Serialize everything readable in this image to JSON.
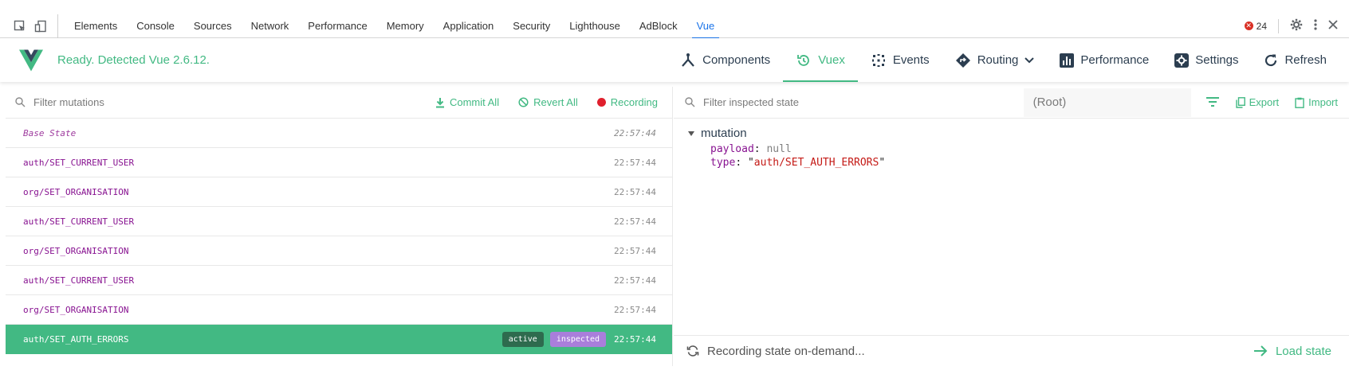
{
  "devtools": {
    "tabs": [
      "Elements",
      "Console",
      "Sources",
      "Network",
      "Performance",
      "Memory",
      "Application",
      "Security",
      "Lighthouse",
      "AdBlock",
      "Vue"
    ],
    "active_tab": "Vue",
    "error_count": "24"
  },
  "vue": {
    "status": "Ready. Detected Vue 2.6.12.",
    "nav": {
      "components": "Components",
      "vuex": "Vuex",
      "events": "Events",
      "routing": "Routing",
      "performance": "Performance",
      "settings": "Settings",
      "refresh": "Refresh"
    },
    "brand_color": "#42b983"
  },
  "mutations_panel": {
    "filter_placeholder": "Filter mutations",
    "commit_all": "Commit All",
    "revert_all": "Revert All",
    "recording": "Recording",
    "items": [
      {
        "name": "Base State",
        "time": "22:57:44"
      },
      {
        "name": "auth/SET_CURRENT_USER",
        "time": "22:57:44"
      },
      {
        "name": "org/SET_ORGANISATION",
        "time": "22:57:44"
      },
      {
        "name": "auth/SET_CURRENT_USER",
        "time": "22:57:44"
      },
      {
        "name": "org/SET_ORGANISATION",
        "time": "22:57:44"
      },
      {
        "name": "auth/SET_CURRENT_USER",
        "time": "22:57:44"
      },
      {
        "name": "org/SET_ORGANISATION",
        "time": "22:57:44"
      }
    ],
    "selected": {
      "name": "auth/SET_AUTH_ERRORS",
      "time": "22:57:44",
      "badge_active": "active",
      "badge_inspected": "inspected"
    }
  },
  "state_panel": {
    "filter_placeholder": "Filter inspected state",
    "root_select": "(Root)",
    "export": "Export",
    "import": "Import",
    "section": "mutation",
    "payload_key": "payload",
    "payload_value": "null",
    "type_key": "type",
    "type_value": "auth/SET_AUTH_ERRORS",
    "recording_status": "Recording state on-demand...",
    "load_state": "Load state"
  }
}
